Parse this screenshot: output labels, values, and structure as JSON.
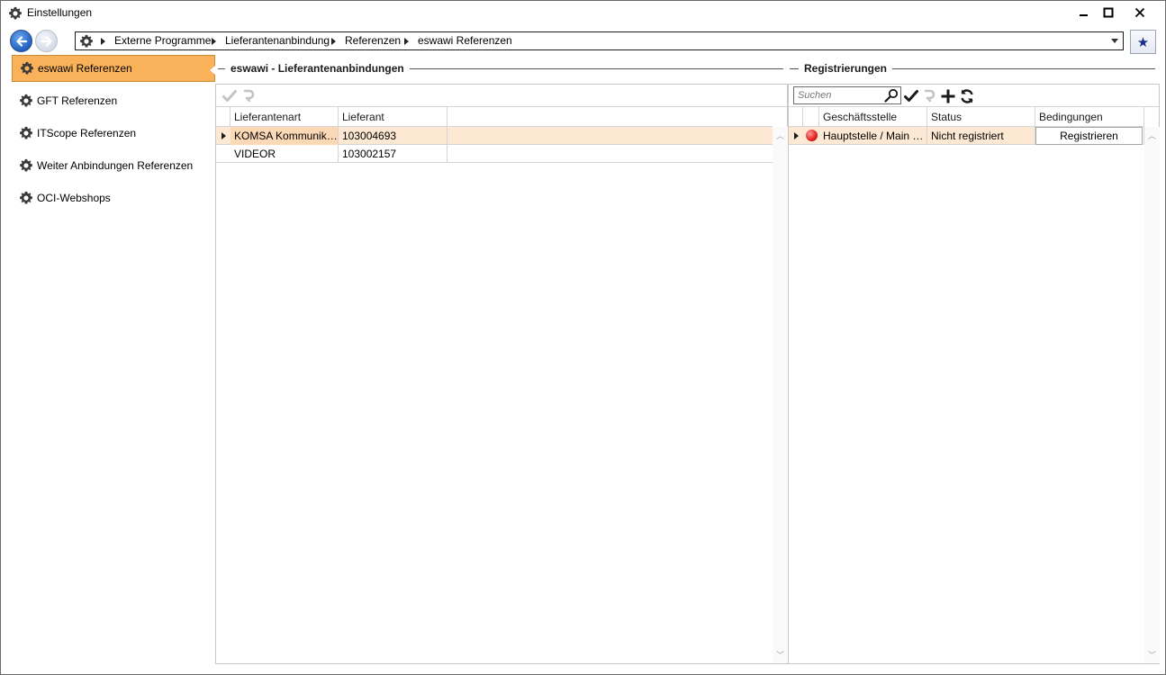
{
  "window": {
    "title": "Einstellungen",
    "controls": {
      "minimize": "–",
      "maximize": "☐",
      "close": "✕"
    }
  },
  "nav": {
    "breadcrumbs": [
      "Externe Programme",
      "Lieferantenanbindung",
      "Referenzen",
      "eswawi Referenzen"
    ],
    "favorite_icon": "★"
  },
  "sidebar": {
    "items": [
      {
        "label": "eswawi Referenzen",
        "active": true
      },
      {
        "label": "GFT Referenzen",
        "active": false
      },
      {
        "label": "ITScope Referenzen",
        "active": false
      },
      {
        "label": "Weiter Anbindungen Referenzen",
        "active": false
      },
      {
        "label": "OCI-Webshops",
        "active": false
      }
    ]
  },
  "left_panel": {
    "title": "eswawi - Lieferantenanbindungen",
    "columns": [
      "Lieferantenart",
      "Lieferant"
    ],
    "rows": [
      {
        "lieferantenart": "KOMSA Kommunikation",
        "lieferant": "103004693",
        "selected": true
      },
      {
        "lieferantenart": "VIDEOR",
        "lieferant": "103002157",
        "selected": false
      }
    ]
  },
  "right_panel": {
    "title": "Registrierungen",
    "search_placeholder": "Suchen",
    "columns": [
      "Geschäftsstelle",
      "Status",
      "Bedingungen"
    ],
    "rows": [
      {
        "geschaeftsstelle": "Hauptstelle / Main office",
        "status": "Nicht registriert",
        "action": "Registrieren",
        "status_color": "#e02020"
      }
    ]
  },
  "colors": {
    "accent": "#f9b25a",
    "selected_row": "#fde9d3",
    "nav_back": "#1f5fc0",
    "fav_star": "#1a2e8a"
  }
}
